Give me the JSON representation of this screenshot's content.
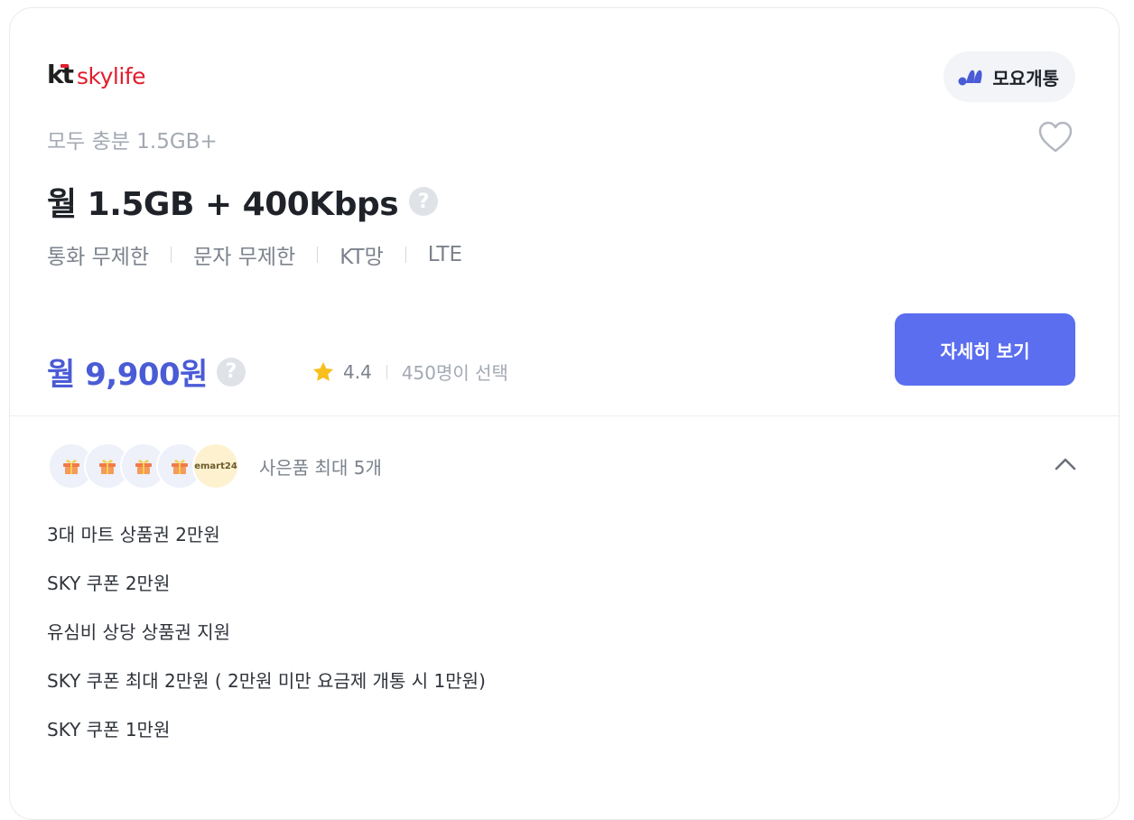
{
  "brand": {
    "kt": "kt",
    "name": "skylife"
  },
  "badge": {
    "label": "모요개통",
    "accent": "#4a5bd6"
  },
  "plan": {
    "subtitle": "모두 충분 1.5GB+",
    "title": "월 1.5GB + 400Kbps",
    "help_glyph": "?",
    "specs": [
      "통화 무제한",
      "문자 무제한",
      "KT망",
      "LTE"
    ]
  },
  "price": {
    "label": "월 9,900원",
    "help_glyph": "?",
    "color": "#4a5bd6"
  },
  "rating": {
    "score": "4.4",
    "selected": "450명이 선택",
    "star_color": "#f9bf1d"
  },
  "cta": {
    "label": "자세히 보기",
    "color": "#5b6ef0"
  },
  "gifts": {
    "summary": "사은품 최대 5개",
    "emart_label": "emart24",
    "icons": [
      "gift-icon",
      "gift-icon",
      "gift-icon",
      "gift-icon",
      "emart24-logo"
    ],
    "items": [
      "3대 마트 상품권 2만원",
      "SKY 쿠폰 2만원",
      "유심비 상당 상품권 지원",
      "SKY 쿠폰 최대 2만원 ( 2만원 미만 요금제 개통 시 1만원)",
      "SKY 쿠폰 1만원"
    ],
    "expanded": true
  }
}
